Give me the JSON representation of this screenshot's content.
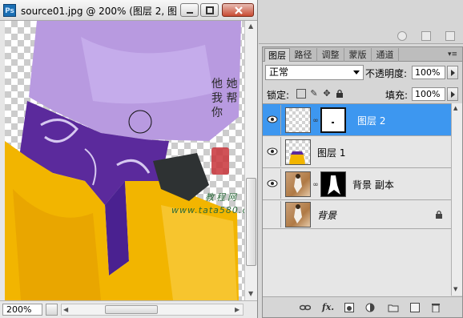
{
  "window": {
    "title": "source01.jpg @ 200% (图层 2, 图...",
    "app_icon_label": "Ps"
  },
  "canvas": {
    "watermark_lines": [
      "他",
      "她",
      "我",
      "帮",
      "你"
    ],
    "watermark_site": "www.tata580.com",
    "watermark_tagline": "教程网"
  },
  "status": {
    "zoom": "200%"
  },
  "layers_panel": {
    "tabs": [
      {
        "label": "图层",
        "active": true
      },
      {
        "label": "路径",
        "active": false
      },
      {
        "label": "调整",
        "active": false
      },
      {
        "label": "蒙版",
        "active": false
      },
      {
        "label": "通道",
        "active": false
      }
    ],
    "blend_mode": "正常",
    "opacity_label": "不透明度:",
    "opacity_value": "100%",
    "lock_label": "锁定:",
    "fill_label": "填充:",
    "fill_value": "100%",
    "layers": [
      {
        "name": "图层 2",
        "selected": true,
        "has_mask": true,
        "visible": true
      },
      {
        "name": "图层 1",
        "selected": false,
        "has_mask": false,
        "visible": true
      },
      {
        "name": "背景 副本",
        "selected": false,
        "has_mask": true,
        "visible": true
      },
      {
        "name": "背景",
        "selected": false,
        "has_mask": false,
        "visible": false,
        "locked": true
      }
    ],
    "footer_icons": [
      "link-icon",
      "fx-icon",
      "mask-icon",
      "adjustment-icon",
      "group-icon",
      "new-layer-icon",
      "trash-icon"
    ]
  },
  "colors": {
    "selected_row": "#3d97f0",
    "purple_fabric": "#5b2a9c",
    "yellow_fabric": "#f2b500"
  }
}
